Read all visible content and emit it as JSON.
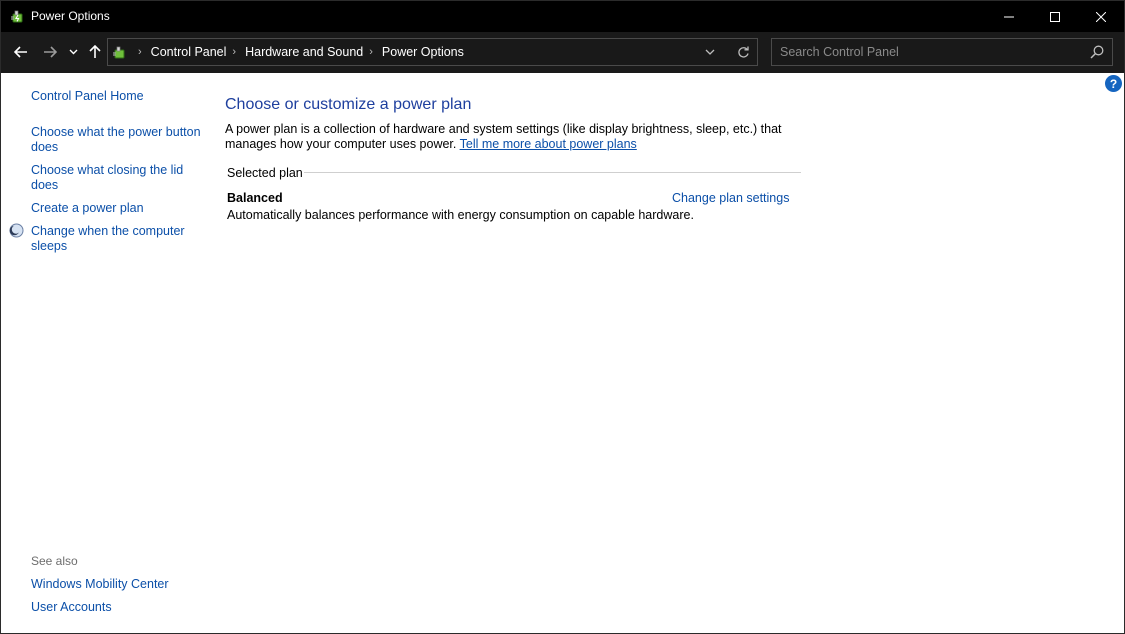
{
  "window": {
    "title": "Power Options"
  },
  "address": {
    "crumbs": [
      "Control Panel",
      "Hardware and Sound",
      "Power Options"
    ]
  },
  "search": {
    "placeholder": "Search Control Panel"
  },
  "help": {
    "label": "?"
  },
  "sidebar": {
    "items": [
      {
        "label": "Control Panel Home"
      },
      {
        "label": "Choose what the power button does"
      },
      {
        "label": "Choose what closing the lid does"
      },
      {
        "label": "Create a power plan"
      },
      {
        "label": "Change when the computer sleeps"
      }
    ],
    "see_also_label": "See also",
    "see_also": [
      {
        "label": "Windows Mobility Center"
      },
      {
        "label": "User Accounts"
      }
    ]
  },
  "main": {
    "title": "Choose or customize a power plan",
    "description": "A power plan is a collection of hardware and system settings (like display brightness, sleep, etc.) that manages how your computer uses power.",
    "learn_more": "Tell me more about power plans",
    "section_label": "Selected plan",
    "plan": {
      "name": "Balanced",
      "description": "Automatically balances performance with energy consumption on capable hardware.",
      "settings_link": "Change plan settings"
    }
  },
  "colors": {
    "titlebar": "#000000",
    "navbar": "#1a1a1a",
    "link": "#0b4fa8",
    "heading": "#1e3f9e"
  }
}
